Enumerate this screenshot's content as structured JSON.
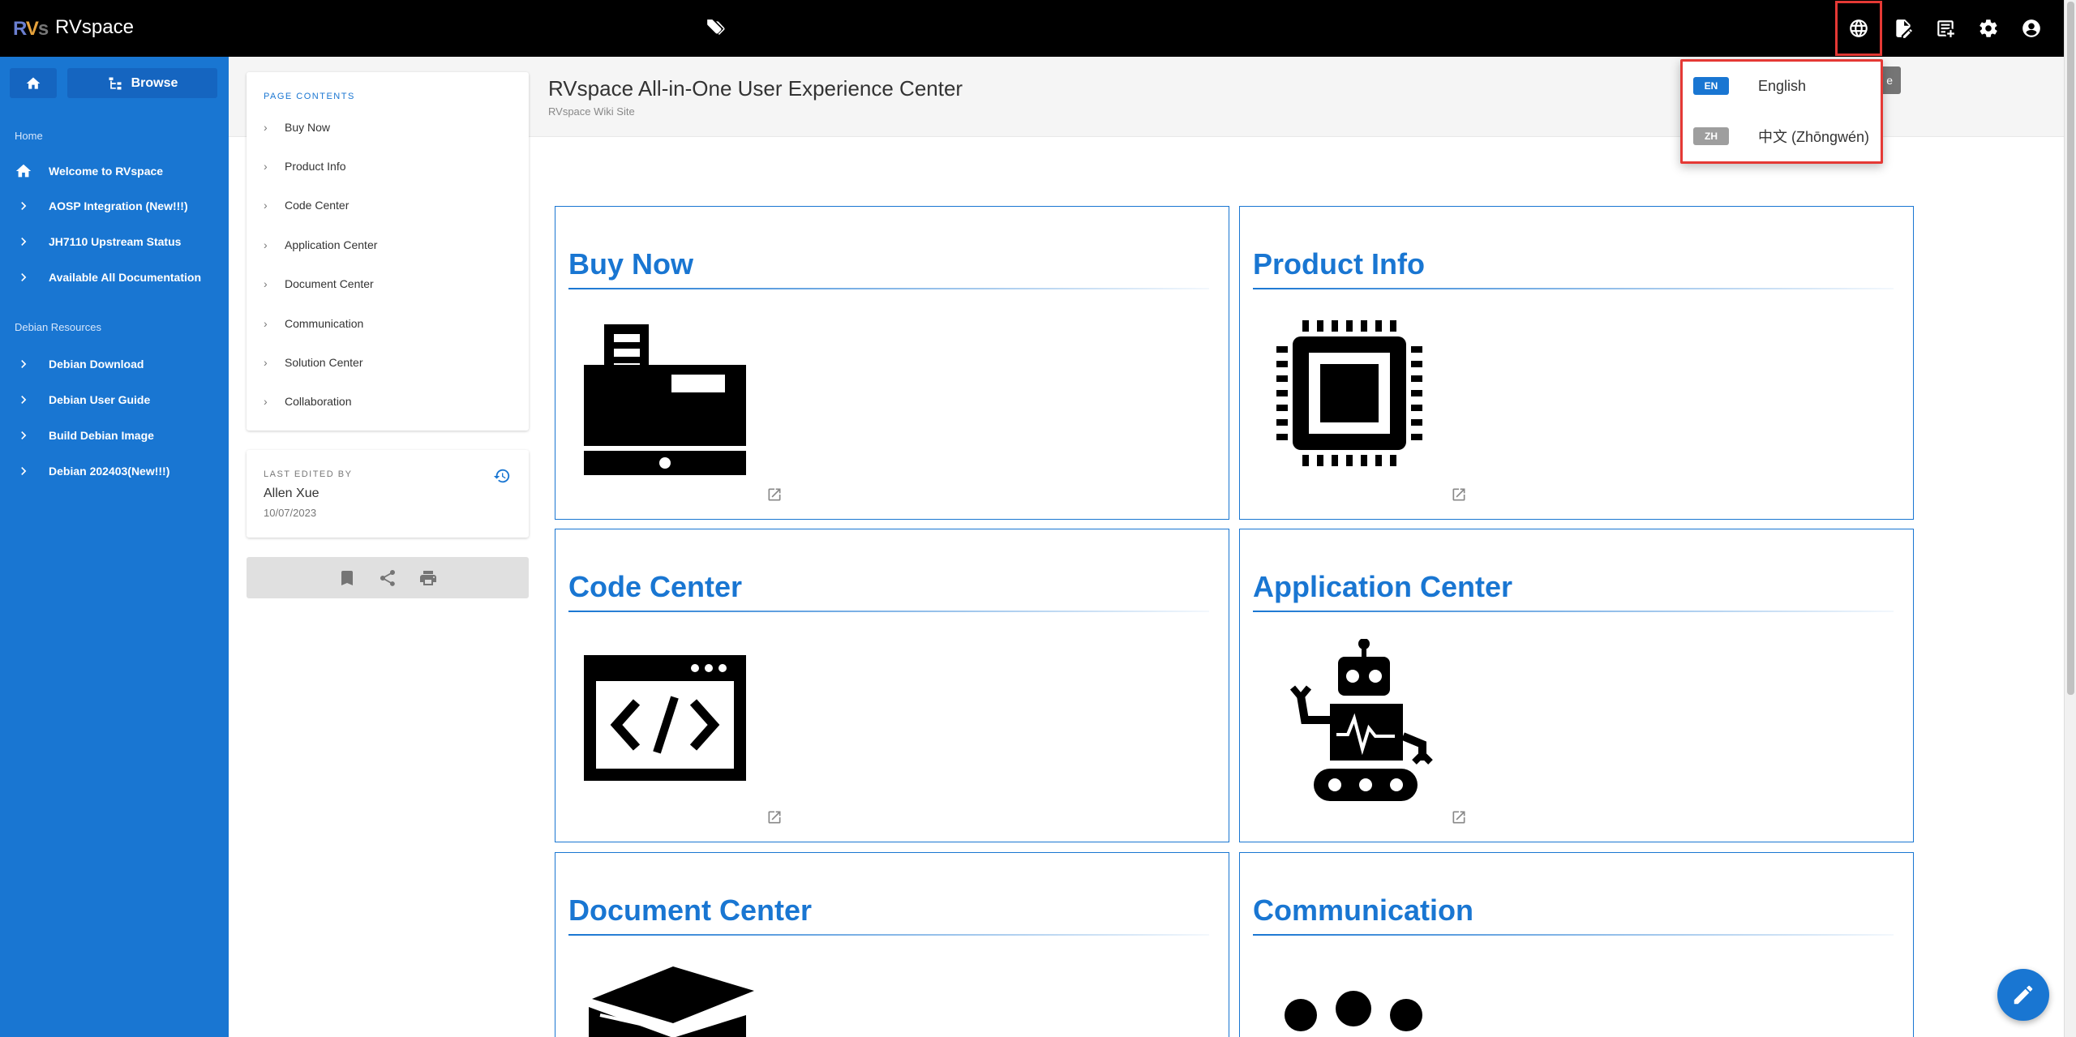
{
  "app": {
    "logo_parts": [
      "R",
      "V",
      "s"
    ],
    "title": "RVspace"
  },
  "sidebar": {
    "browse_label": "Browse",
    "sections": [
      {
        "label": "Home",
        "items": [
          {
            "label": "Welcome to RVspace",
            "icon": "home-icon"
          },
          {
            "label": "AOSP Integration (New!!!)",
            "icon": "chevron-right-icon"
          },
          {
            "label": "JH7110 Upstream Status",
            "icon": "chevron-right-icon"
          },
          {
            "label": "Available All Documentation",
            "icon": "chevron-right-icon"
          }
        ]
      },
      {
        "label": "Debian Resources",
        "items": [
          {
            "label": "Debian Download",
            "icon": "chevron-right-icon"
          },
          {
            "label": "Debian User Guide",
            "icon": "chevron-right-icon"
          },
          {
            "label": "Build Debian Image",
            "icon": "chevron-right-icon"
          },
          {
            "label": "Debian 202403(New!!!)",
            "icon": "chevron-right-icon"
          }
        ]
      }
    ]
  },
  "page": {
    "title": "RVspace All-in-One User Experience Center",
    "subtitle": "RVspace Wiki Site",
    "hidden_button_fragment": "e"
  },
  "toc": {
    "heading": "PAGE CONTENTS",
    "items": [
      "Buy Now",
      "Product Info",
      "Code Center",
      "Application Center",
      "Document Center",
      "Communication",
      "Solution Center",
      "Collaboration"
    ]
  },
  "last_edited": {
    "heading": "LAST EDITED BY",
    "author": "Allen Xue",
    "date": "10/07/2023"
  },
  "cards": [
    {
      "title": "Buy Now",
      "icon": "cash-register-icon"
    },
    {
      "title": "Product Info",
      "icon": "chip-icon"
    },
    {
      "title": "Code Center",
      "icon": "code-window-icon"
    },
    {
      "title": "Application Center",
      "icon": "robot-icon"
    },
    {
      "title": "Document Center",
      "icon": "book-icon"
    },
    {
      "title": "Communication",
      "icon": "people-icon"
    }
  ],
  "language_menu": {
    "options": [
      {
        "code": "EN",
        "name": "English",
        "color": "#1976d2"
      },
      {
        "code": "ZH",
        "name": "中文 (Zhōngwén)",
        "color": "#9e9e9e"
      }
    ]
  },
  "colors": {
    "primary": "#1976d2",
    "topbar": "#000000",
    "highlight": "#e53935"
  }
}
